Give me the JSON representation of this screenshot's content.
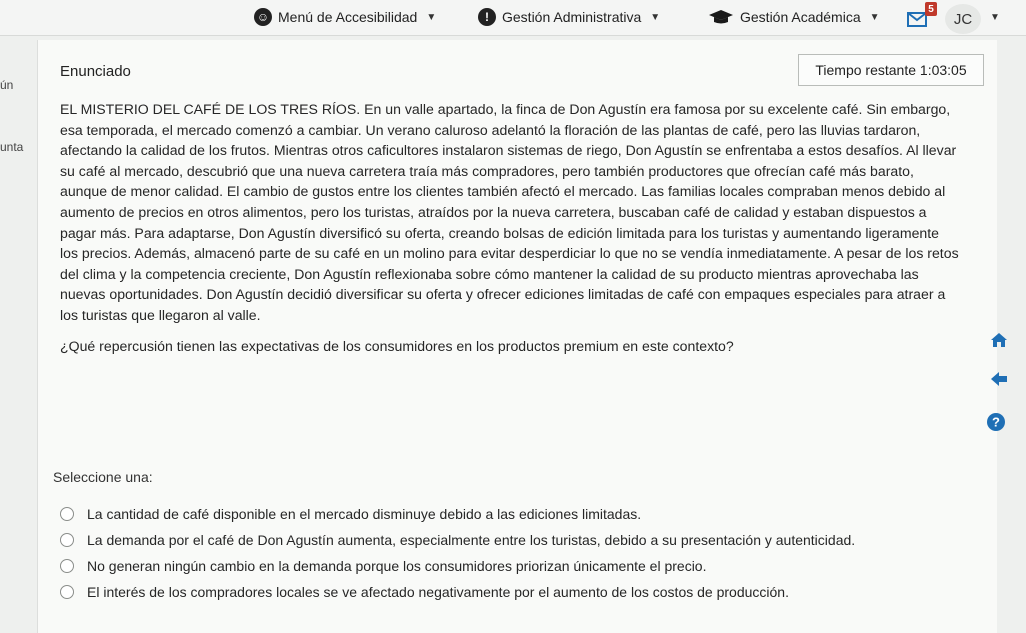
{
  "topbar": {
    "accessibility_label": "Menú de Accesibilidad",
    "admin_label": "Gestión Administrativa",
    "academic_label": "Gestión Académica",
    "notification_count": "5",
    "user_initials": "JC"
  },
  "sidebar_fragments": {
    "item1": "ún",
    "item2": "unta"
  },
  "question": {
    "heading": "Enunciado",
    "timer_label": "Tiempo restante",
    "timer_value": "1:03:05",
    "paragraphs": [
      "EL MISTERIO DEL CAFÉ DE LOS TRES RÍOS. En un valle apartado, la finca de Don Agustín era famosa por su excelente café. Sin embargo, esa temporada, el mercado comenzó a cambiar. Un verano caluroso adelantó la floración de las plantas de café, pero las lluvias tardaron, afectando la calidad de los frutos. Mientras otros caficultores instalaron sistemas de riego, Don Agustín se enfrentaba a estos desafíos. Al llevar su café al mercado, descubrió que una nueva carretera traía más compradores, pero también productores que ofrecían café más barato, aunque de menor calidad. El cambio de gustos entre los clientes también afectó el mercado. Las familias locales compraban menos debido al aumento de precios en otros alimentos, pero los turistas, atraídos por la nueva carretera, buscaban café de calidad y estaban dispuestos a pagar más. Para adaptarse, Don Agustín diversificó su oferta, creando bolsas de edición limitada para los turistas y aumentando ligeramente los precios. Además, almacenó parte de su café en un molino para evitar desperdiciar lo que no se vendía inmediatamente. A pesar de los retos del clima y la competencia creciente, Don Agustín reflexionaba sobre cómo mantener la calidad de su producto mientras aprovechaba las nuevas oportunidades. Don Agustín decidió diversificar su oferta y ofrecer ediciones limitadas de café con empaques especiales para atraer a los turistas que llegaron al valle."
    ],
    "prompt": "¿Qué repercusión tienen las expectativas de los consumidores en los productos premium en este contexto?",
    "select_label": "Seleccione una:",
    "options": [
      "La cantidad de café disponible en el mercado disminuye debido a las ediciones limitadas.",
      "La demanda por el café de Don Agustín aumenta, especialmente entre los turistas, debido a su presentación y autenticidad.",
      "No generan ningún cambio en la demanda porque los consumidores priorizan únicamente el precio.",
      "El interés de los compradores locales se ve afectado negativamente por el aumento de los costos de producción."
    ]
  },
  "icons": {
    "home": "home-icon",
    "back": "arrow-left-icon",
    "help": "help-icon"
  },
  "colors": {
    "accent": "#1f6fb5",
    "background": "#eef0ee",
    "card": "#f9faf8"
  }
}
